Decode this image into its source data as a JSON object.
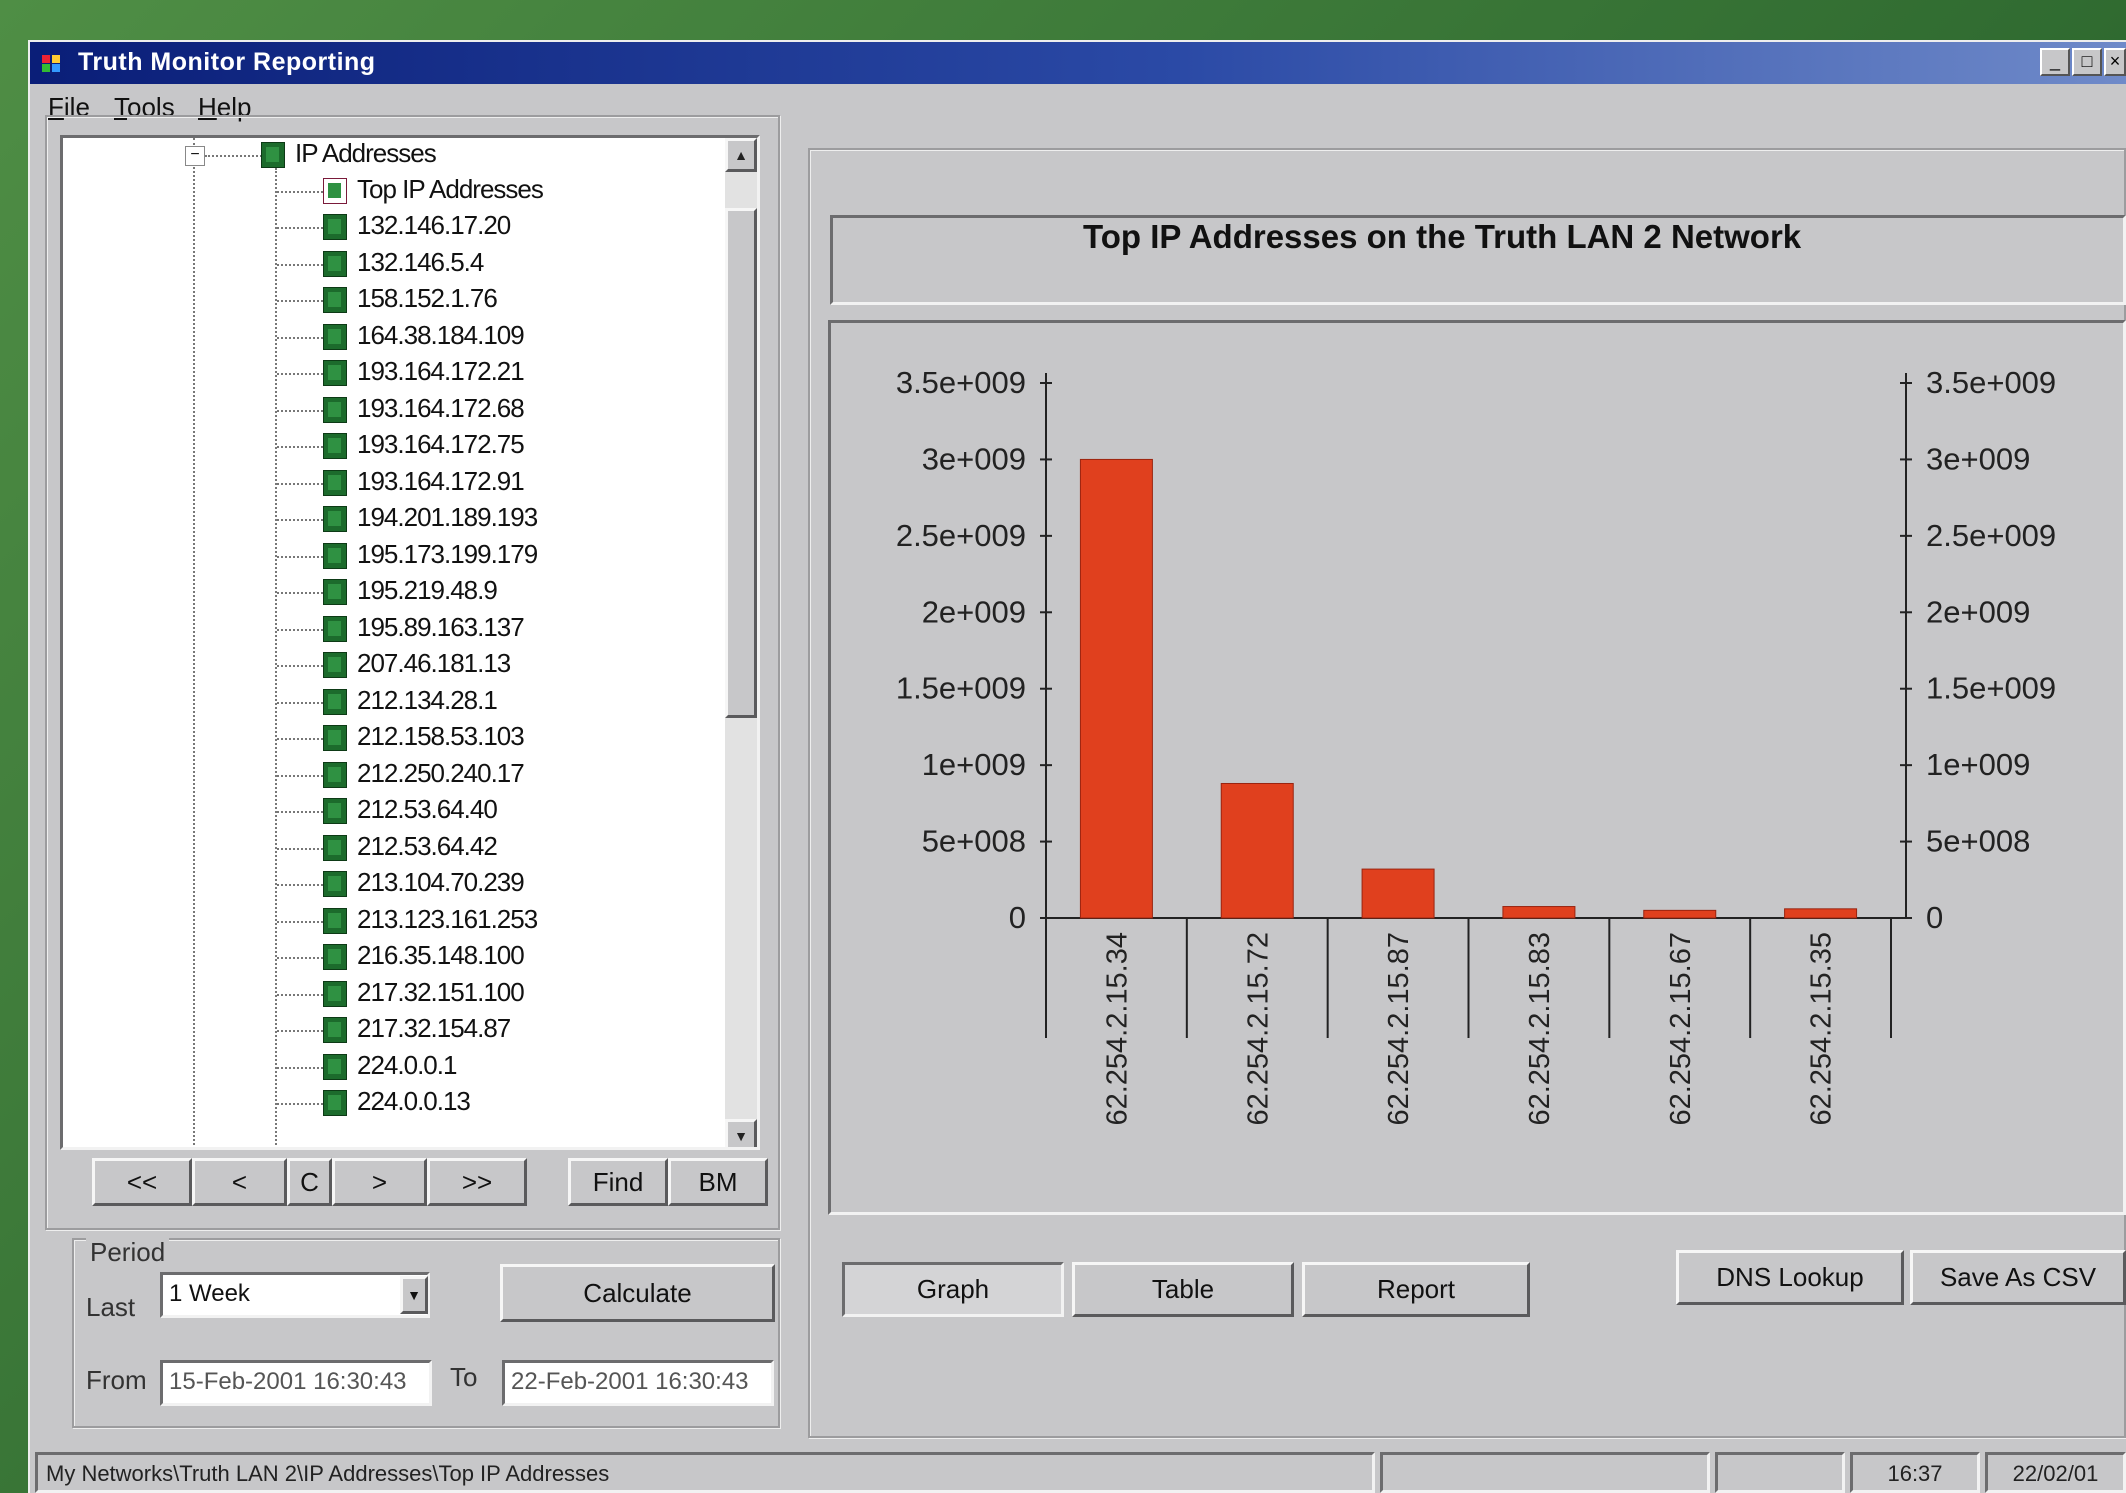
{
  "window": {
    "title": "Truth Monitor Reporting"
  },
  "menu": {
    "items": [
      "File",
      "Tools",
      "Help"
    ]
  },
  "tree": {
    "root_label": "IP Addresses",
    "child_label": "Top IP Addresses",
    "items": [
      "132.146.17.20",
      "132.146.5.4",
      "158.152.1.76",
      "164.38.184.109",
      "193.164.172.21",
      "193.164.172.68",
      "193.164.172.75",
      "193.164.172.91",
      "194.201.189.193",
      "195.173.199.179",
      "195.219.48.9",
      "195.89.163.137",
      "207.46.181.13",
      "212.134.28.1",
      "212.158.53.103",
      "212.250.240.17",
      "212.53.64.40",
      "212.53.64.42",
      "213.104.70.239",
      "213.123.161.253",
      "216.35.148.100",
      "217.32.151.100",
      "217.32.154.87",
      "224.0.0.1",
      "224.0.0.13"
    ]
  },
  "nav": {
    "first": "<<",
    "prev": "<",
    "current": "C",
    "next": ">",
    "last": ">>",
    "find": "Find",
    "bm": "BM"
  },
  "period": {
    "legend": "Period",
    "last_label": "Last",
    "last_value": "1 Week",
    "calculate": "Calculate",
    "from_label": "From",
    "from_value": "15-Feb-2001 16:30:43",
    "to_label": "To",
    "to_value": "22-Feb-2001 16:30:43"
  },
  "chart_data": {
    "type": "bar",
    "title": "Top IP Addresses on the Truth LAN 2 Network",
    "categories": [
      "62.254.2.15.34",
      "62.254.2.15.72",
      "62.254.2.15.87",
      "62.254.2.15.83",
      "62.254.2.15.67",
      "62.254.2.15.35"
    ],
    "values": [
      3000000000,
      880000000,
      320000000,
      75000000,
      50000000,
      60000000
    ],
    "ylim": [
      0,
      3500000000
    ],
    "y_ticks": [
      "0",
      "5e+008",
      "1e+009",
      "1.5e+009",
      "2e+009",
      "2.5e+009",
      "3e+009",
      "3.5e+009"
    ],
    "bar_color": "#e0401e"
  },
  "views": {
    "graph": "Graph",
    "table": "Table",
    "report": "Report",
    "dns": "DNS Lookup",
    "csv": "Save As CSV"
  },
  "status": {
    "path": "My Networks\\Truth LAN 2\\IP Addresses\\Top IP Addresses",
    "time": "16:37",
    "date": "22/02/01"
  }
}
